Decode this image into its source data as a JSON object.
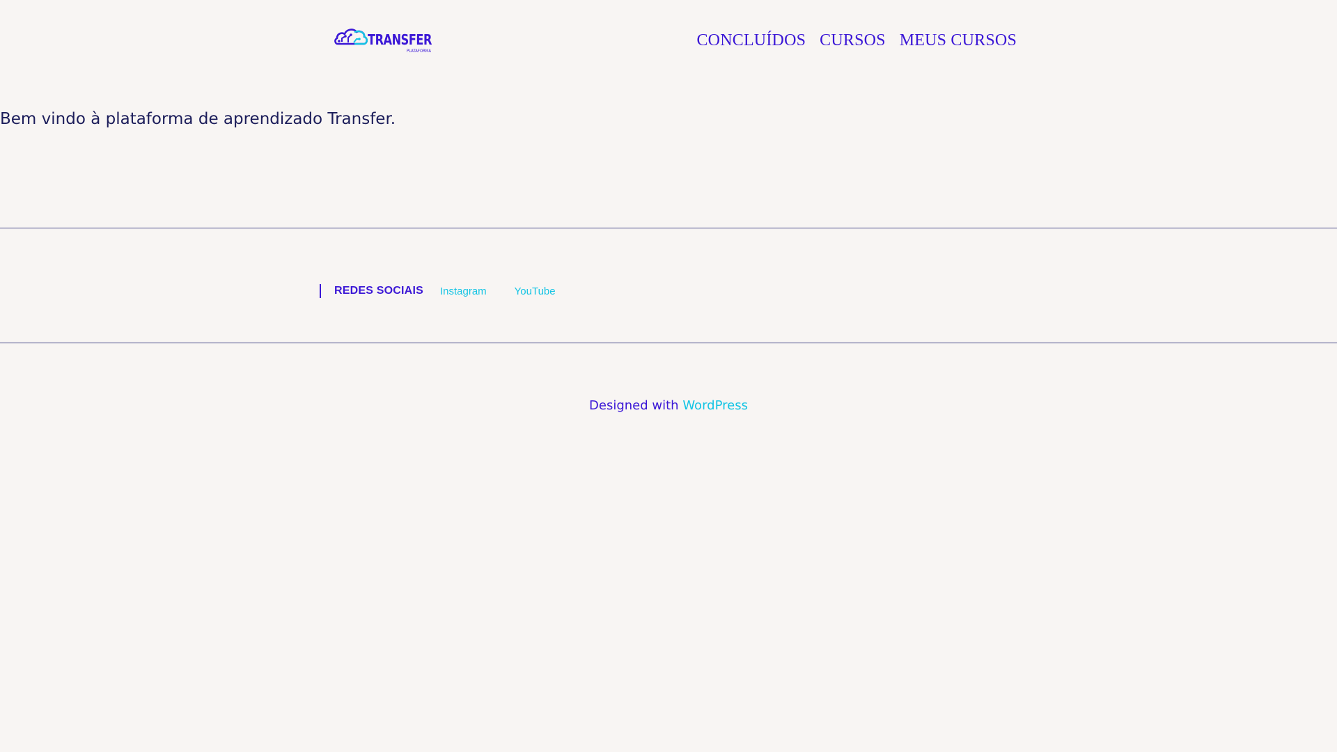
{
  "header": {
    "logo": {
      "name": "TRANSFER",
      "tagline": "PLATAFORMA",
      "colors": {
        "primary": "#3b17d6",
        "accent": "#15c4e4"
      }
    },
    "nav": [
      {
        "label": "CONCLUÍDOS"
      },
      {
        "label": "CURSOS"
      },
      {
        "label": "MEUS CURSOS"
      }
    ]
  },
  "main": {
    "welcome": "Bem vindo à plataforma de aprendizado Transfer."
  },
  "social": {
    "heading": "REDES SOCIAIS",
    "links": [
      {
        "label": "Instagram"
      },
      {
        "label": "YouTube"
      }
    ]
  },
  "footer": {
    "credit_text": "Designed with",
    "credit_link": "WordPress"
  },
  "theme": {
    "background": "#f8f5f3",
    "text": "#1c1d5a",
    "link": "#3b17d6",
    "accent": "#15c4e4"
  }
}
